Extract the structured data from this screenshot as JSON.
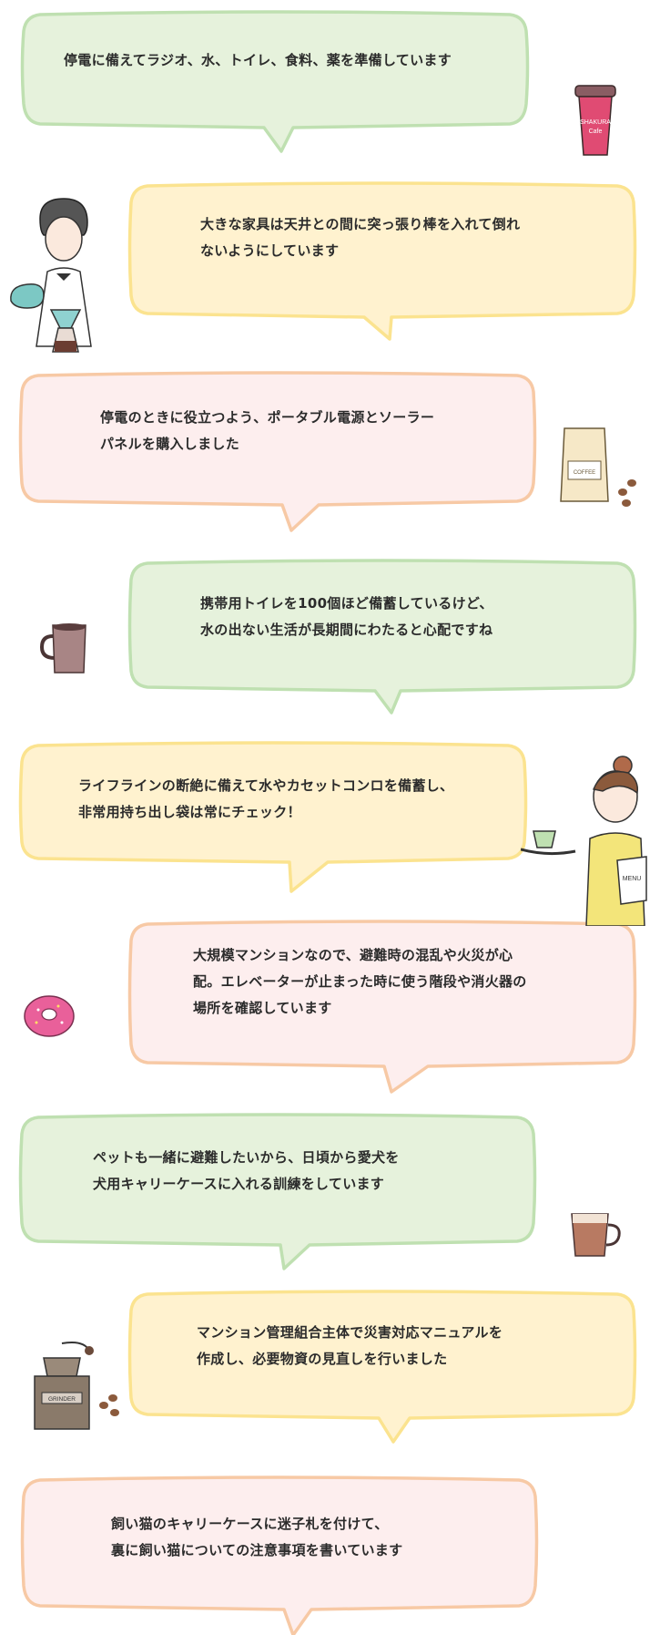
{
  "colors": {
    "green_fill": "#e6f2dc",
    "green_stroke": "#bfe0b1",
    "yellow_fill": "#fff2cf",
    "yellow_stroke": "#fbe38f",
    "pink_fill": "#fdeeee",
    "pink_stroke": "#f7c9a5"
  },
  "messages": [
    {
      "theme": "green",
      "text": "停電に備えてラジオ、水、トイレ、食料、薬を準備しています"
    },
    {
      "theme": "yellow",
      "text": "大きな家具は天井との間に突っ張り棒を入れて倒れ\nないようにしています"
    },
    {
      "theme": "pink",
      "text": "停電のときに役立つよう、ポータブル電源とソーラー\nパネルを購入しました"
    },
    {
      "theme": "green",
      "text": "携帯用トイレを100個ほど備蓄しているけど、\n水の出ない生活が長期間にわたると心配ですね"
    },
    {
      "theme": "yellow",
      "text": "ライフラインの断絶に備えて水やカセットコンロを備蓄し、\n非常用持ち出し袋は常にチェック！"
    },
    {
      "theme": "pink",
      "text": "大規模マンションなので、避難時の混乱や火災が心\n配。エレベーターが止まった時に使う階段や消火器の\n場所を確認しています"
    },
    {
      "theme": "green",
      "text": "ペットも一緒に避難したいから、日頃から愛犬を\n犬用キャリーケースに入れる訓練をしています"
    },
    {
      "theme": "yellow",
      "text": "マンション管理組合主体で災害対応マニュアルを\n作成し、必要物資の見直しを行いました"
    },
    {
      "theme": "pink",
      "text": "飼い猫のキャリーケースに迷子札を付けて、\n裏に飼い猫についての注意事項を書いています"
    }
  ],
  "illustrations": {
    "cup_label_1": "SHAKURA",
    "cup_label_2": "Cafe",
    "coffee_bag_label": "COFFEE",
    "menu_label": "MENU",
    "grinder_label": "GRINDER"
  }
}
